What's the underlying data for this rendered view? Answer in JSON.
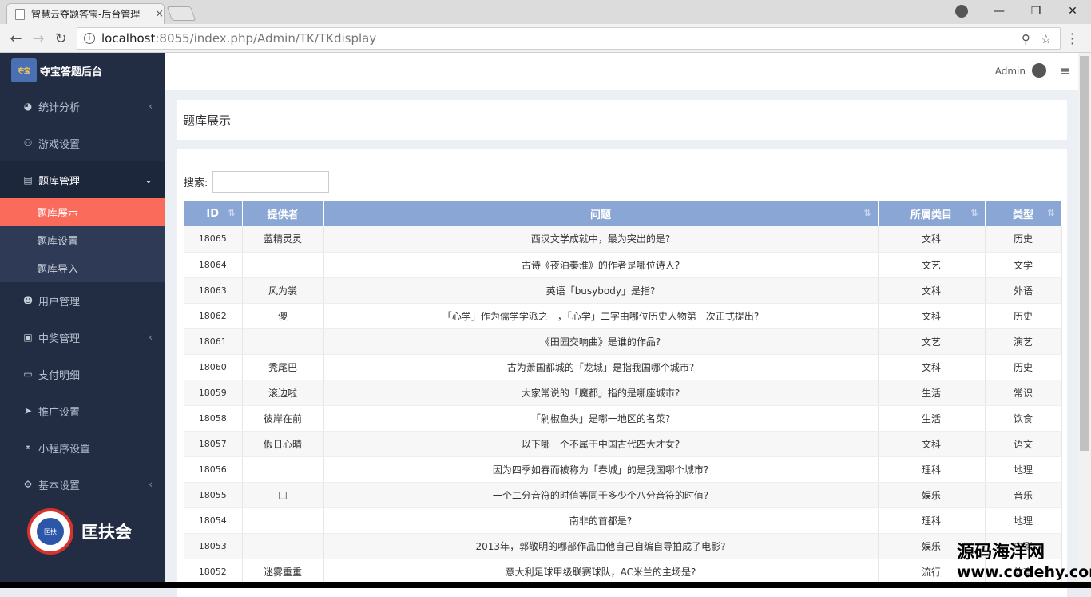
{
  "browser": {
    "tab_title": "智慧云夺题答宝-后台管理",
    "tab_close": "×",
    "url_host": "localhost",
    "url_rest": ":8055/index.php/Admin/TK/TKdisplay",
    "back": "←",
    "forward": "→",
    "reload": "↻",
    "minimize": "—",
    "maximize": "❐",
    "close": "✕",
    "zoom_icon": "⚲",
    "star_icon": "☆"
  },
  "sidebar": {
    "logo_text": "夺宝答题后台",
    "logo_img_text": "夺宝",
    "items": [
      {
        "label": "统计分析",
        "icon": "◕",
        "chev": "‹"
      },
      {
        "label": "游戏设置",
        "icon": "⚇",
        "chev": ""
      },
      {
        "label": "题库管理",
        "icon": "▤",
        "chev": "⌄"
      },
      {
        "label": "用户管理",
        "icon": "☻",
        "chev": ""
      },
      {
        "label": "中奖管理",
        "icon": "▣",
        "chev": "‹"
      },
      {
        "label": "支付明细",
        "icon": "▭",
        "chev": ""
      },
      {
        "label": "推广设置",
        "icon": "➤",
        "chev": ""
      },
      {
        "label": "小程序设置",
        "icon": "⚭",
        "chev": ""
      },
      {
        "label": "基本设置",
        "icon": "⚙",
        "chev": "‹"
      }
    ],
    "sub_items": [
      "题库展示",
      "题库设置",
      "题库导入"
    ],
    "brand_text": "匡扶会",
    "badge_text": "匡扶"
  },
  "topbar": {
    "user": "Admin",
    "menu_icon": "≡"
  },
  "page_title": "题库展示",
  "search": {
    "label": "搜索:",
    "value": ""
  },
  "table": {
    "headers": [
      "ID",
      "提供者",
      "问题",
      "所属类目",
      "类型"
    ],
    "sort_icons": [
      "⇅",
      "",
      "⇅",
      "⇅",
      "⇅"
    ],
    "rows": [
      [
        "18065",
        "蓝精灵灵",
        "西汉文学成就中，最为突出的是?",
        "文科",
        "历史"
      ],
      [
        "18064",
        "",
        "古诗《夜泊秦淮》的作者是哪位诗人?",
        "文艺",
        "文学"
      ],
      [
        "18063",
        "风为裳",
        "英语「busybody」是指?",
        "文科",
        "外语"
      ],
      [
        "18062",
        "傻",
        "「心学」作为儒学学派之一，「心学」二字由哪位历史人物第一次正式提出?",
        "文科",
        "历史"
      ],
      [
        "18061",
        "",
        "《田园交响曲》是谁的作品?",
        "文艺",
        "演艺"
      ],
      [
        "18060",
        "秃尾巴",
        "古为萧国都城的「龙城」是指我国哪个城市?",
        "文科",
        "历史"
      ],
      [
        "18059",
        "滚边啦",
        "大家常说的「魔都」指的是哪座城市?",
        "生活",
        "常识"
      ],
      [
        "18058",
        "彼岸在前",
        "「剁椒鱼头」是哪一地区的名菜?",
        "生活",
        "饮食"
      ],
      [
        "18057",
        "假日心晴",
        "以下哪一个不属于中国古代四大才女?",
        "文科",
        "语文"
      ],
      [
        "18056",
        "",
        "因为四季如春而被称为「春城」的是我国哪个城市?",
        "理科",
        "地理"
      ],
      [
        "18055",
        "□",
        "一个二分音符的时值等同于多少个八分音符的时值?",
        "娱乐",
        "音乐"
      ],
      [
        "18054",
        "",
        "南非的首都是?",
        "理科",
        "地理"
      ],
      [
        "18053",
        "",
        "2013年，郭敬明的哪部作品由他自己自编自导拍成了电影?",
        "娱乐",
        "电影"
      ],
      [
        "18052",
        "迷雾重重",
        "意大利足球甲级联赛球队，AC米兰的主场是?",
        "流行",
        "体育"
      ]
    ]
  },
  "watermark": {
    "line1": "源码海洋网",
    "line2": "www.codehy.com"
  }
}
